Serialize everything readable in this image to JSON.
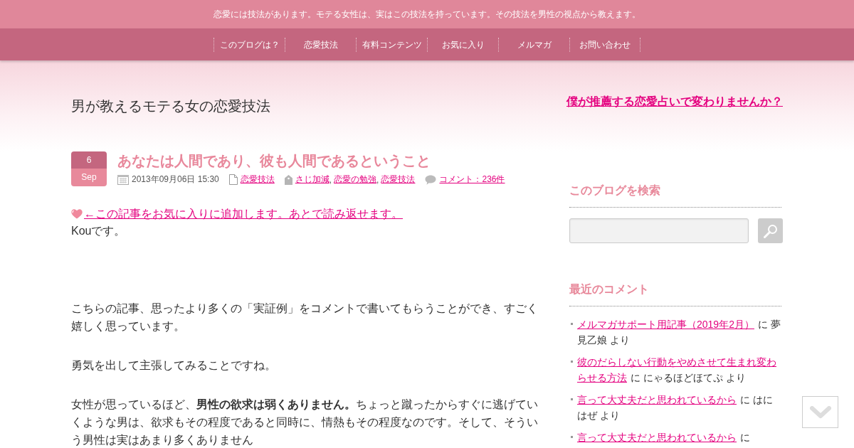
{
  "tagline": "恋愛には技法があります。モテる女性は、実はこの技法を持っています。その技法を男性の視点から教えます。",
  "nav": [
    {
      "label": "このブログは？"
    },
    {
      "label": "恋愛技法"
    },
    {
      "label": "有料コンテンツ"
    },
    {
      "label": "お気に入り"
    },
    {
      "label": "メルマガ"
    },
    {
      "label": "お問い合わせ"
    }
  ],
  "site_title": "男が教えるモテる女の恋愛技法",
  "promo_link": "僕が推薦する恋愛占いで変わりませんか？",
  "post": {
    "date": {
      "day": "6",
      "month": "Sep"
    },
    "title": "あなたは人間であり、彼も人間であるということ",
    "meta": {
      "datetime": "2013年09月06日 15:30",
      "category": "恋愛技法",
      "tags": [
        "さじ加減",
        "恋愛の勉強",
        "恋愛技法"
      ],
      "tag_separator": ",",
      "comments": "コメント：236件"
    },
    "favorite_link": "←この記事をお気に入りに追加します。あとで読み返せます。",
    "greeting": "Kouです。",
    "paragraphs": [
      "こちらの記事、思ったより多くの「実証例」をコメントで書いてもらうことができ、すごく嬉しく思っています。",
      "勇気を出して主張してみることですね。",
      "女性が思っているほど、**男性の欲求は弱くありません。**ちょっと蹴ったからすぐに逃げていくような男は、欲求もその程度であると同時に、情熱もその程度なのです。そして、そういう男性は実はあまり多くありません"
    ]
  },
  "sidebar": {
    "search": {
      "title": "このブログを検索"
    },
    "recent_comments": {
      "title": "最近のコメント",
      "items": [
        {
          "link": "メルマガサポート用記事（2019年2月）",
          "byline": "に 夢見乙娘 より"
        },
        {
          "link": "彼のだらしない行動をやめさせて生まれ変わらせる方法",
          "byline": "に にゃるほどほてぷ より"
        },
        {
          "link": "言って大丈夫だと思われているから",
          "byline": "に はにはぜ より"
        },
        {
          "link": "言って大丈夫だと思われているから",
          "byline": "に"
        }
      ]
    }
  }
}
